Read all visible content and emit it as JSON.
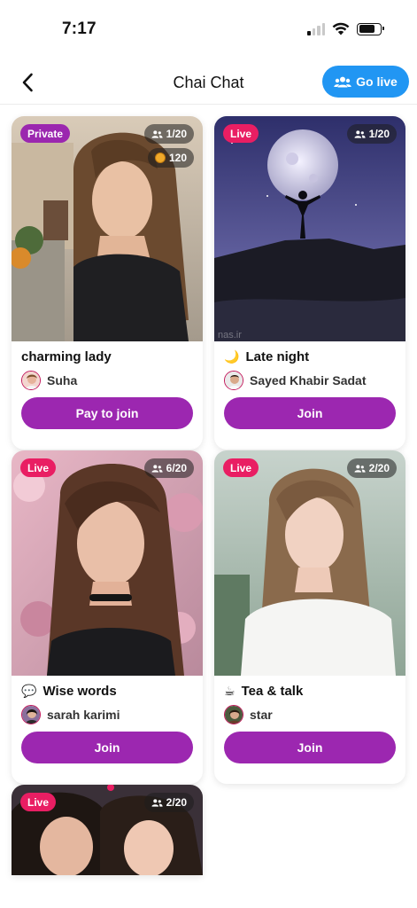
{
  "status_bar": {
    "time": "7:17"
  },
  "header": {
    "title": "Chai Chat",
    "go_live_label": "Go live"
  },
  "rooms": [
    {
      "tag": "Private",
      "tag_color": "#9b27af",
      "count": "1/20",
      "coins": "120",
      "title": "charming lady",
      "title_icon": "",
      "host": "Suha",
      "button": "Pay to join"
    },
    {
      "tag": "Live",
      "tag_color": "#e91e63",
      "count": "1/20",
      "title": "Late night",
      "title_icon": "🌙",
      "host": "Sayed Khabir Sadat",
      "button": "Join",
      "watermark": "nas.ir"
    },
    {
      "tag": "Live",
      "tag_color": "#e91e63",
      "count": "6/20",
      "title": "Wise words",
      "title_icon": "💬",
      "host": "sarah karimi",
      "button": "Join"
    },
    {
      "tag": "Live",
      "tag_color": "#e91e63",
      "count": "2/20",
      "title": "Tea & talk",
      "title_icon": "☕",
      "host": "star",
      "button": "Join"
    },
    {
      "tag": "Live",
      "tag_color": "#e91e63",
      "count": "2/20"
    }
  ],
  "colors": {
    "accent_purple": "#9c27b0",
    "go_live_blue": "#2196f3",
    "live_pink": "#e91e63"
  },
  "icons": {
    "back": "chevron-left-icon",
    "go_live": "group-icon",
    "count": "people-icon",
    "coin": "coin-icon"
  }
}
